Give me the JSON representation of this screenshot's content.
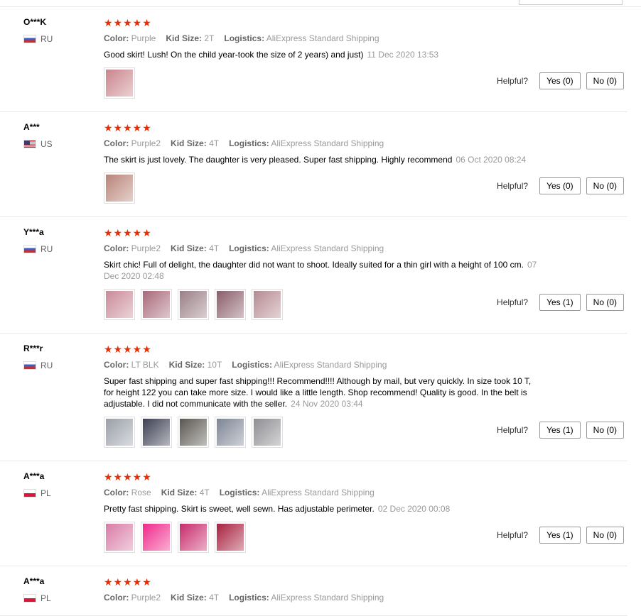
{
  "labels": {
    "color": "Color:",
    "kid_size": "Kid Size:",
    "logistics": "Logistics:",
    "helpful": "Helpful?"
  },
  "reviews": [
    {
      "user": "O***K",
      "country": "RU",
      "stars": "★★★★★",
      "color": "Purple",
      "kid_size": "2T",
      "logistics": "AliExpress Standard Shipping",
      "text": "Good skirt! Lush! On the child year-took the size of 2 years) and just)",
      "date": "11 Dec 2020 13:53",
      "photos": [
        "#c9858c"
      ],
      "yes": "Yes (0)",
      "no": "No (0)"
    },
    {
      "user": "A***",
      "country": "US",
      "stars": "★★★★★",
      "color": "Purple2",
      "kid_size": "4T",
      "logistics": "AliExpress Standard Shipping",
      "text": "The skirt is just lovely. The daughter is very pleased. Super fast shipping. Highly recommend",
      "date": "06 Oct 2020 08:24",
      "photos": [
        "#b88478"
      ],
      "yes": "Yes (0)",
      "no": "No (0)"
    },
    {
      "user": "Y***a",
      "country": "RU",
      "stars": "★★★★★",
      "color": "Purple2",
      "kid_size": "4T",
      "logistics": "AliExpress Standard Shipping",
      "text": "Skirt chic! Full of delight, the daughter did not want to shoot. Ideally suited for a thin girl with a height of 100 cm.",
      "date": "07 Dec 2020 02:48",
      "photos": [
        "#c98a98",
        "#a8697a",
        "#9a7f86",
        "#8a5d6a",
        "#b58a92"
      ],
      "yes": "Yes (1)",
      "no": "No (0)"
    },
    {
      "user": "R***r",
      "country": "RU",
      "stars": "★★★★★",
      "color": "LT BLK",
      "kid_size": "10T",
      "logistics": "AliExpress Standard Shipping",
      "text": "Super fast shipping and super fast shipping!!! Recommend!!!! Although by mail, but very quickly. In size took 10 T, for height 122 you can take more size. I would like a little length. Shop recommend! Quality is good. In the belt is adjustable. I did not communicate with the seller.",
      "date": "24 Nov 2020 03:44",
      "photos": [
        "#9aa0a8",
        "#3c3f52",
        "#5a5650",
        "#7d8594",
        "#8e8e93"
      ],
      "yes": "Yes (1)",
      "no": "No (0)"
    },
    {
      "user": "A***a",
      "country": "PL",
      "stars": "★★★★★",
      "color": "Rose",
      "kid_size": "4T",
      "logistics": "AliExpress Standard Shipping",
      "text": "Pretty fast shipping. Skirt is sweet, well sewn. Has adjustable perimeter.",
      "date": "02 Dec 2020 00:08",
      "photos": [
        "#d97ca6",
        "#f0288a",
        "#c82b6c",
        "#a8203e"
      ],
      "yes": "Yes (1)",
      "no": "No (0)"
    },
    {
      "user": "A***a",
      "country": "PL",
      "stars": "★★★★★",
      "color": "Purple2",
      "kid_size": "4T",
      "logistics": "AliExpress Standard Shipping",
      "text": "",
      "date": "",
      "photos": [],
      "yes": "",
      "no": ""
    }
  ]
}
